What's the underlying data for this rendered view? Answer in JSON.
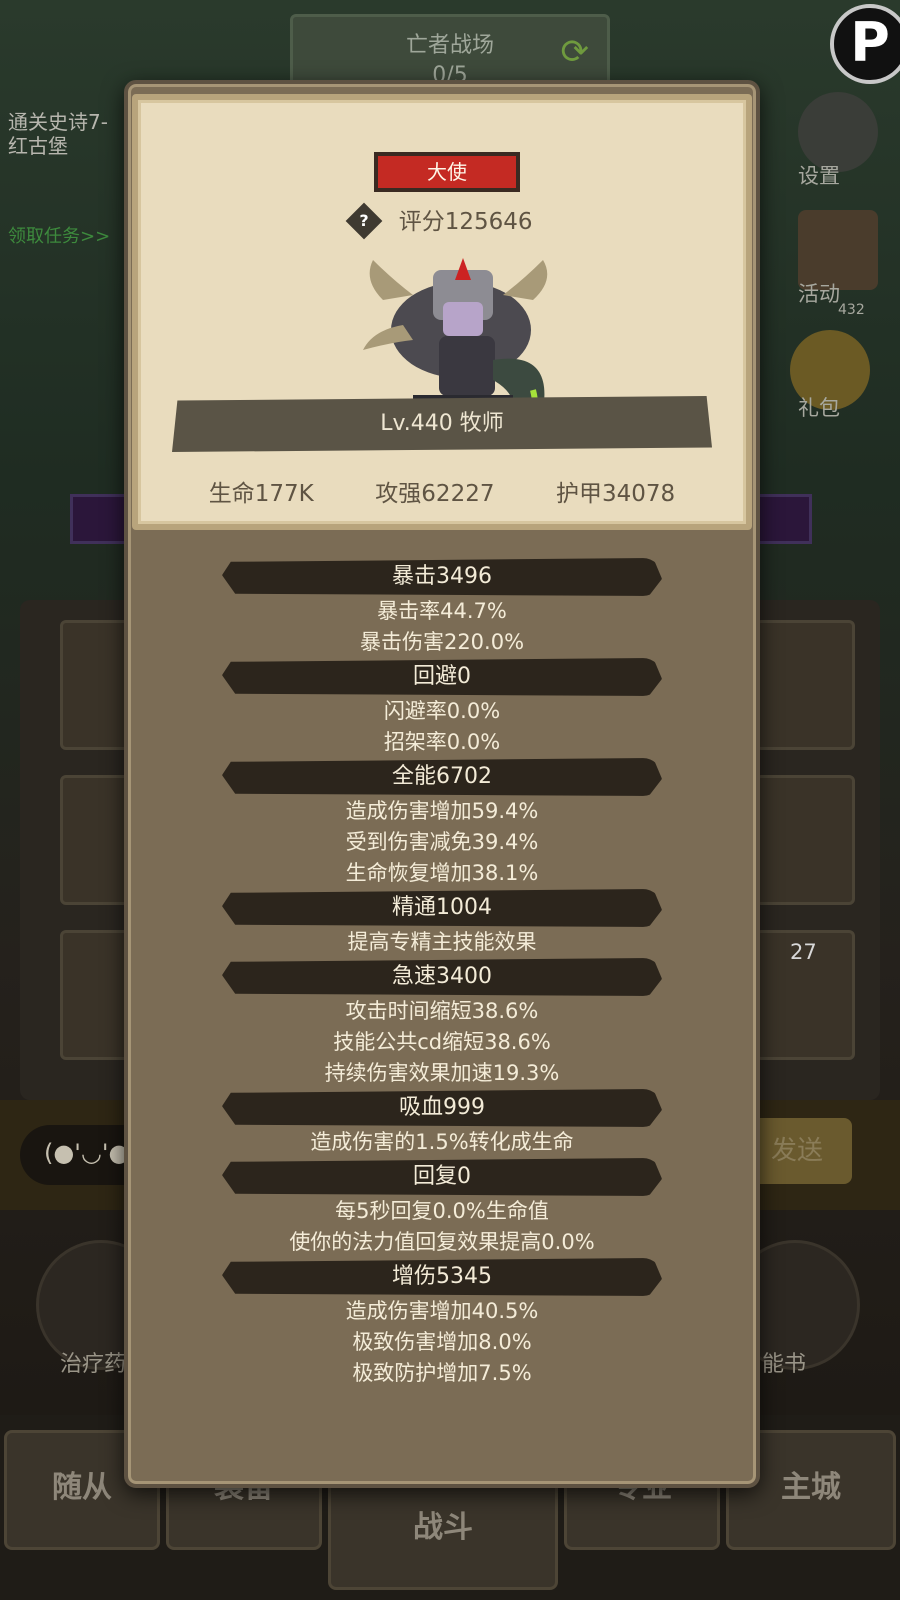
{
  "background": {
    "top_banner": {
      "title": "亡者战场",
      "progress": "0/5"
    },
    "quest": {
      "line1": "通关史诗7-",
      "line2": "红古堡",
      "link": "领取任务>>"
    },
    "side_menu": [
      {
        "label": "设置"
      },
      {
        "label": "活动",
        "badge": "432"
      },
      {
        "label": "礼包"
      }
    ],
    "chat": {
      "input_preview": "(●'◡'●",
      "send_label": "发送"
    },
    "quick_buttons": [
      {
        "label": "治疗药"
      },
      {
        "label": "能书"
      }
    ],
    "card_badge": "27",
    "nav": [
      "随从",
      "装备",
      "战斗",
      "专业",
      "主城"
    ]
  },
  "hero": {
    "rank": "大使",
    "score": "评分125646",
    "level_class": "Lv.440 牧师",
    "stats": [
      "生命177K",
      "攻强62227",
      "护甲34078"
    ]
  },
  "attributes": [
    {
      "header": "暴击3496",
      "lines": [
        "暴击率44.7%",
        "暴击伤害220.0%"
      ]
    },
    {
      "header": "回避0",
      "lines": [
        "闪避率0.0%",
        "招架率0.0%"
      ]
    },
    {
      "header": "全能6702",
      "lines": [
        "造成伤害增加59.4%",
        "受到伤害减免39.4%",
        "生命恢复增加38.1%"
      ]
    },
    {
      "header": "精通1004",
      "lines": [
        "提高专精主技能效果"
      ]
    },
    {
      "header": "急速3400",
      "lines": [
        "攻击时间缩短38.6%",
        "技能公共cd缩短38.6%",
        "持续伤害效果加速19.3%"
      ]
    },
    {
      "header": "吸血999",
      "lines": [
        "造成伤害的1.5%转化成生命"
      ]
    },
    {
      "header": "回复0",
      "lines": [
        "每5秒回复0.0%生命值",
        "使你的法力值回复效果提高0.0%"
      ]
    },
    {
      "header": "增伤5345",
      "lines": [
        "造成伤害增加40.5%",
        "极致伤害增加8.0%",
        "极致防护增加7.5%"
      ]
    }
  ]
}
